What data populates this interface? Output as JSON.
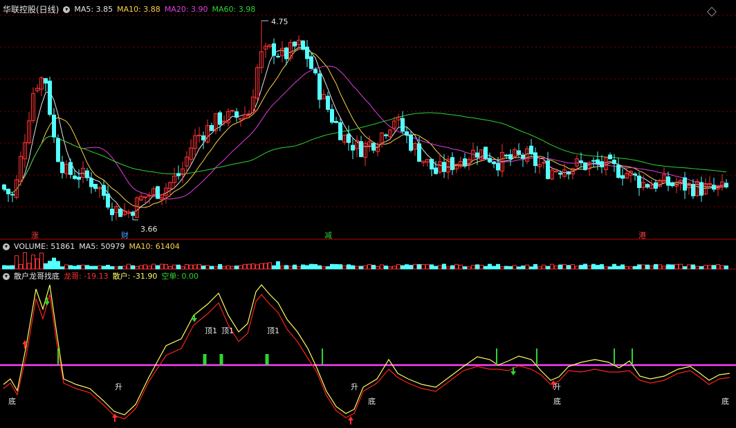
{
  "price_panel": {
    "title": "华联控股(日线)",
    "indicators": [
      {
        "label": "MA5: 3.85",
        "color": "#e6e6e6"
      },
      {
        "label": "MA10: 3.88",
        "color": "#ffd24a"
      },
      {
        "label": "MA20: 3.90",
        "color": "#e040e0"
      },
      {
        "label": "MA60: 3.98",
        "color": "#2fd52f"
      }
    ],
    "high_label": "4.75",
    "low_label": "3.66",
    "event_tags": [
      {
        "text": "涨",
        "color": "#ff4040"
      },
      {
        "text": "财",
        "color": "#4aa0ff"
      },
      {
        "text": "减",
        "color": "#2fd52f"
      },
      {
        "text": "港",
        "color": "#ff4040"
      }
    ]
  },
  "volume_panel": {
    "title": "VOLUME: 51861",
    "ma5": "MA5: 50979",
    "ma10": "MA10: 61404"
  },
  "indicator_panel": {
    "title": "散户龙哥找底",
    "longge": "龙哥: -19.13",
    "sanhu": "散户: -31.90",
    "kongdan": "空单: 0.00",
    "annotations": [
      "底",
      "升",
      "顶1",
      "顶1",
      "顶1",
      "升",
      "底",
      "升",
      "底",
      "底"
    ]
  },
  "colors": {
    "up": "#ff3232",
    "down": "#54ffff",
    "ma5": "#e6e6e6",
    "ma10": "#ffd24a",
    "ma20": "#e040e0",
    "ma60": "#2fd52f",
    "grid": "#8b0000",
    "longge_line": "#ff2020",
    "sanhu_line": "#ffff60",
    "zero_line": "#ff40ff"
  }
}
